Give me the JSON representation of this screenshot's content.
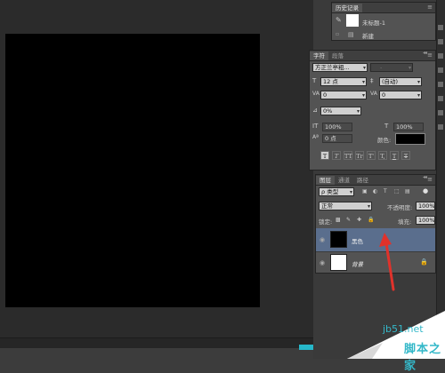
{
  "history": {
    "tabs": [
      "历史记录"
    ],
    "snapshot_label": "未标题-1",
    "step_label": "新建"
  },
  "character": {
    "tabs": [
      "字符",
      "段落"
    ],
    "font_family": "方正兰亭粗...",
    "font_style": "-",
    "font_size": "12 点",
    "leading": "(自动)",
    "kerning": "0",
    "tracking": "0",
    "baseline_shift_percent": "0%",
    "vertical_scale": "100%",
    "horizontal_scale": "100%",
    "baseline_shift": "0 点",
    "color_label": "颜色:",
    "color_value": "#000000",
    "style_buttons": [
      "T",
      "T",
      "TT",
      "Tr",
      "T'",
      "T,",
      "T",
      "T"
    ]
  },
  "layers": {
    "tabs": [
      "图层",
      "通道",
      "路径"
    ],
    "filter_kind": "ρ 类型",
    "blend_mode": "正常",
    "opacity_label": "不透明度:",
    "opacity_value": "100%",
    "lock_label": "锁定:",
    "fill_label": "填充:",
    "fill_value": "100%",
    "items": [
      {
        "name": "黑色",
        "thumb_color": "#000000",
        "selected": true
      },
      {
        "name": "背景",
        "thumb_color": "#ffffff",
        "selected": false
      }
    ]
  },
  "watermark": {
    "url": "jb51.net",
    "name": "脚本之家"
  },
  "colors": {
    "accent": "#34b8c9",
    "arrow": "#e0322b",
    "selection": "#5a6e8d"
  }
}
